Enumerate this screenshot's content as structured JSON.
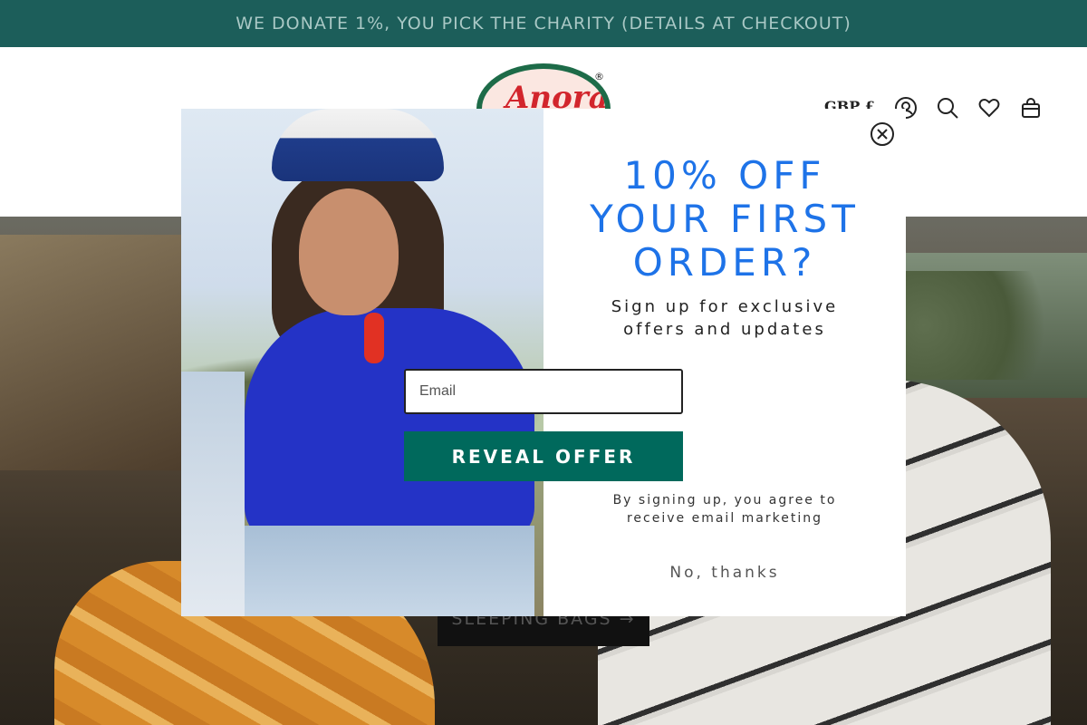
{
  "announcement": {
    "text": "WE DONATE 1%, YOU PICK THE CHARITY (DETAILS AT CHECKOUT)"
  },
  "header": {
    "logo_text": "Anorak",
    "logo_reg": "®",
    "currency": "GBP £",
    "icons": [
      "account-icon",
      "search-icon",
      "wishlist-heart-icon",
      "cart-bag-icon"
    ]
  },
  "hero": {
    "cta_label": "SLEEPING BAGS →"
  },
  "popup": {
    "headline_line1": "10% OFF",
    "headline_line2": "YOUR FIRST",
    "headline_line3": "ORDER?",
    "subtext_line1": "Sign up for exclusive",
    "subtext_line2": "offers and updates",
    "email_placeholder": "Email",
    "reveal_label": "REVEAL OFFER",
    "legal_line1": "By signing up, you agree to",
    "legal_line2": "receive email marketing",
    "decline_label": "No, thanks",
    "accent_color": "#1e73e8",
    "button_color": "#00695c"
  }
}
